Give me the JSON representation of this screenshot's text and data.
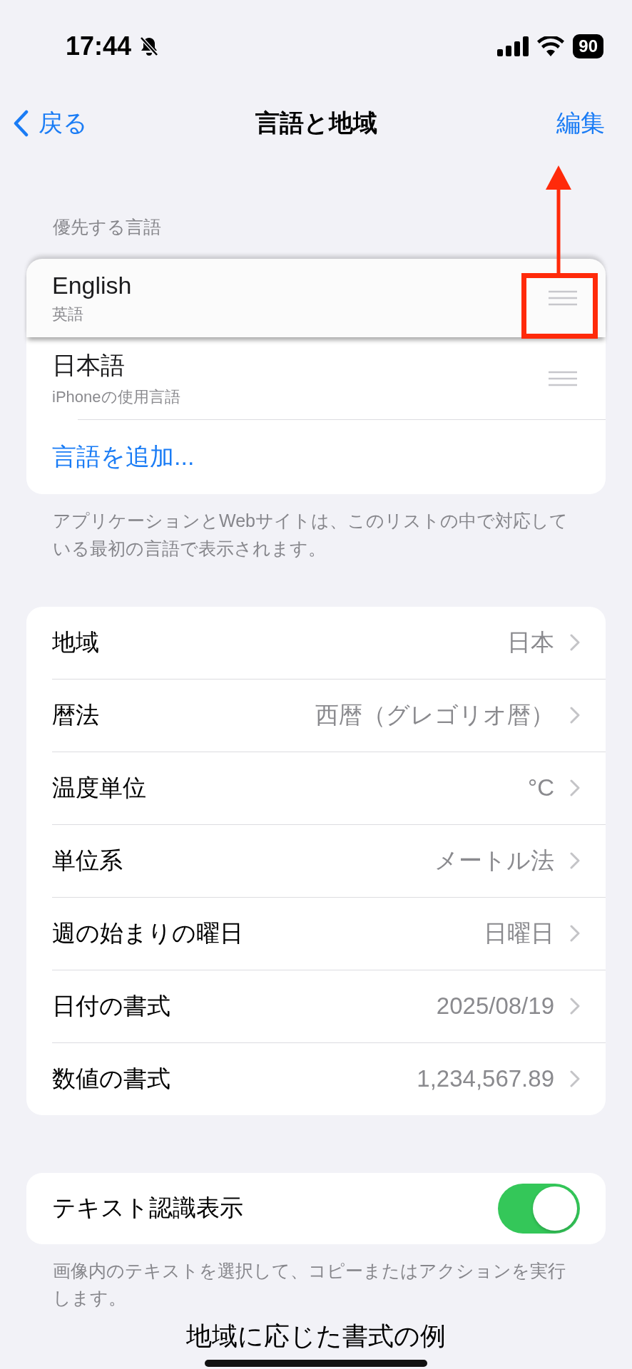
{
  "status_bar": {
    "time": "17:44",
    "battery": "90"
  },
  "nav": {
    "back": "戻る",
    "title": "言語と地域",
    "action": "編集"
  },
  "preferred_languages": {
    "header": "優先する言語",
    "items": [
      {
        "name": "English",
        "subtitle": "英語",
        "dragging": true
      },
      {
        "name": "日本語",
        "subtitle": "iPhoneの使用言語",
        "dragging": false
      }
    ],
    "add": "言語を追加...",
    "footer": "アプリケーションとWebサイトは、このリストの中で対応している最初の言語で表示されます。"
  },
  "settings": [
    {
      "label": "地域",
      "value": "日本"
    },
    {
      "label": "暦法",
      "value": "西暦（グレゴリオ暦）"
    },
    {
      "label": "温度単位",
      "value": "°C"
    },
    {
      "label": "単位系",
      "value": "メートル法"
    },
    {
      "label": "週の始まりの曜日",
      "value": "日曜日"
    },
    {
      "label": "日付の書式",
      "value": "2025/08/19"
    },
    {
      "label": "数値の書式",
      "value": "1,234,567.89"
    }
  ],
  "live_text": {
    "label": "テキスト認識表示",
    "on": true,
    "footer": "画像内のテキストを選択して、コピーまたはアクションを実行します。"
  },
  "section_heading": "地域に応じた書式の例",
  "annotation": {
    "kind": "arrow-box"
  }
}
